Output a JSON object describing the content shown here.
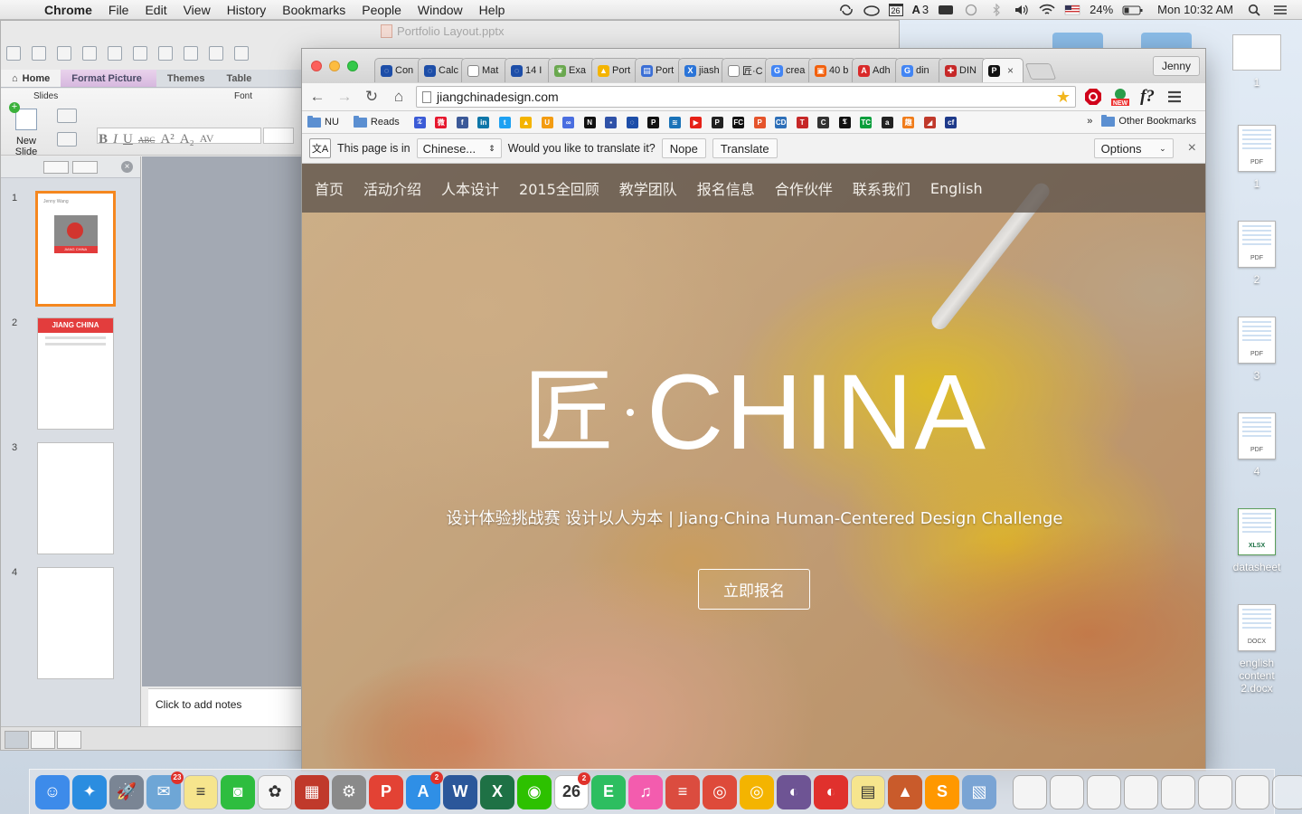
{
  "menubar": {
    "app_name": "Chrome",
    "menus": [
      "File",
      "Edit",
      "View",
      "History",
      "Bookmarks",
      "People",
      "Window",
      "Help"
    ],
    "status": {
      "calendar_day": "26",
      "adobe_count": "3",
      "battery": "24%",
      "clock": "Mon 10:32 AM"
    }
  },
  "powerpoint": {
    "window_title": "Portfolio Layout.pptx",
    "ribbon_tabs": [
      "Home",
      "Format Picture",
      "Themes",
      "Table"
    ],
    "groups": {
      "slides": "Slides",
      "font": "Font"
    },
    "new_slide": "New Slide",
    "format_buttons": [
      "B",
      "I",
      "U",
      "ABC",
      "A²",
      "A₂",
      "AV"
    ],
    "slides": [
      {
        "number": "1",
        "top_text": "Jenny Wang",
        "image_caption": "JIANG CHINA"
      },
      {
        "number": "2",
        "heading": "JIANG CHINA"
      },
      {
        "number": "3"
      },
      {
        "number": "4"
      }
    ],
    "notes_placeholder": "Click to add notes"
  },
  "chrome": {
    "profile": "Jenny",
    "tabs": [
      {
        "label": "Con",
        "fav_color": "#1d4ea8",
        "fav_char": "◌"
      },
      {
        "label": "Calc",
        "fav_color": "#1d4ea8",
        "fav_char": "◌"
      },
      {
        "label": "Mat",
        "fav_color": "#ffffff",
        "fav_char": ""
      },
      {
        "label": "14 I",
        "fav_color": "#1d4ea8",
        "fav_char": "◌"
      },
      {
        "label": "Exa",
        "fav_color": "#6aa84f",
        "fav_char": "❦"
      },
      {
        "label": "Port",
        "fav_color": "#f4b400",
        "fav_char": "▲"
      },
      {
        "label": "Port",
        "fav_color": "#3b6fd6",
        "fav_char": "▤"
      },
      {
        "label": "jiash",
        "fav_color": "#2a74d8",
        "fav_char": "X"
      },
      {
        "label": "匠·C",
        "fav_color": "#ffffff",
        "fav_char": ""
      },
      {
        "label": "crea",
        "fav_color": "#4285f4",
        "fav_char": "G"
      },
      {
        "label": "40 b",
        "fav_color": "#f2600c",
        "fav_char": "▣"
      },
      {
        "label": "Adh",
        "fav_color": "#d92a2a",
        "fav_char": "A"
      },
      {
        "label": "din",
        "fav_color": "#4285f4",
        "fav_char": "G"
      },
      {
        "label": "DIN",
        "fav_color": "#c62828",
        "fav_char": "✚"
      },
      {
        "label": "",
        "fav_color": "#111111",
        "fav_char": "P",
        "active": true
      }
    ],
    "url": "jiangchinadesign.com",
    "bookmarks": [
      {
        "label": "NU",
        "type": "folder"
      },
      {
        "label": "Reads",
        "type": "folder"
      }
    ],
    "bookmark_icons": [
      {
        "name": "tumblr-like-icon",
        "color": "#3b5bd6",
        "char": "𝔗"
      },
      {
        "name": "weibo-icon",
        "color": "#e6162d",
        "char": "微"
      },
      {
        "name": "facebook-icon",
        "color": "#3b5998",
        "char": "f"
      },
      {
        "name": "linkedin-icon",
        "color": "#0e76a8",
        "char": "in"
      },
      {
        "name": "twitter-icon",
        "color": "#1da1f2",
        "char": "t"
      },
      {
        "name": "google-drive-icon",
        "color": "#f4b400",
        "char": "▲"
      },
      {
        "name": "u-icon",
        "color": "#f39c12",
        "char": "U"
      },
      {
        "name": "infinity-icon",
        "color": "#4a6ee0",
        "char": "∞"
      },
      {
        "name": "notion-icon",
        "color": "#111111",
        "char": "N"
      },
      {
        "name": "blue-square-icon",
        "color": "#2f52a8",
        "char": "▪"
      },
      {
        "name": "circle-icon",
        "color": "#1d4ea8",
        "char": "◌"
      },
      {
        "name": "bp-icon",
        "color": "#111111",
        "char": "P"
      },
      {
        "name": "stack-icon",
        "color": "#1a73b8",
        "char": "≋"
      },
      {
        "name": "youtube-icon",
        "color": "#e62117",
        "char": "▶"
      },
      {
        "name": "bp2-icon",
        "color": "#222222",
        "char": "P"
      },
      {
        "name": "fc-icon",
        "color": "#111111",
        "char": "FC"
      },
      {
        "name": "p-icon",
        "color": "#e5542b",
        "char": "P"
      },
      {
        "name": "cd-icon",
        "color": "#2d6fb8",
        "char": "CD"
      },
      {
        "name": "t-icon",
        "color": "#c62828",
        "char": "T"
      },
      {
        "name": "cs-icon",
        "color": "#333333",
        "char": "C"
      },
      {
        "name": "ny-icon",
        "color": "#111111",
        "char": "𝕿"
      },
      {
        "name": "tc-icon",
        "color": "#0a9e3c",
        "char": "TC"
      },
      {
        "name": "amazon-icon",
        "color": "#222222",
        "char": "a"
      },
      {
        "name": "mi-icon",
        "color": "#f07c1a",
        "char": "趣"
      },
      {
        "name": "cap-icon",
        "color": "#c0392b",
        "char": "◢"
      },
      {
        "name": "cf-icon",
        "color": "#1e3a8a",
        "char": "cf"
      }
    ],
    "other_bookmarks": "Other Bookmarks",
    "overflow": "»",
    "translate_bar": {
      "prefix": "This page is in",
      "language": "Chinese...",
      "question": "Would you like to translate it?",
      "nope": "Nope",
      "translate": "Translate",
      "options": "Options",
      "close": "×"
    }
  },
  "site": {
    "nav": [
      "首页",
      "活动介绍",
      "人本设计",
      "2015全回顾",
      "教学团队",
      "报名信息",
      "合作伙伴",
      "联系我们",
      "English"
    ],
    "logo_han": "匠",
    "logo_word": "CHINA",
    "tagline": "设计体验挑战赛 设计以人为本 | Jiang·China Human-Centered Design Challenge",
    "cta": "立即报名"
  },
  "desktop": {
    "files": [
      {
        "label": "1",
        "type": "IMG"
      },
      {
        "label": "1",
        "type": "PDF"
      },
      {
        "label": "2",
        "type": "PDF"
      },
      {
        "label": "3",
        "type": "PDF"
      },
      {
        "label": "4",
        "type": "PDF"
      },
      {
        "label": "datasheet",
        "type": "XLSX"
      },
      {
        "label": "english content 2.docx",
        "type": "DOCX"
      }
    ]
  },
  "dock": {
    "apps": [
      {
        "name": "finder",
        "color": "#3d8bea",
        "char": "☺"
      },
      {
        "name": "safari",
        "color": "#2b8de0",
        "char": "✦"
      },
      {
        "name": "launchpad",
        "color": "#7a8594",
        "char": "🚀"
      },
      {
        "name": "mail",
        "color": "#6ea6d6",
        "char": "✉",
        "badge": "23"
      },
      {
        "name": "notes",
        "color": "#f6e58d",
        "char": "≡"
      },
      {
        "name": "facetime",
        "color": "#2ebd3f",
        "char": "◙"
      },
      {
        "name": "photos",
        "color": "#f5f5f5",
        "char": "✿"
      },
      {
        "name": "photo-booth",
        "color": "#c0392b",
        "char": "▦"
      },
      {
        "name": "system-preferences",
        "color": "#8a8a8a",
        "char": "⚙"
      },
      {
        "name": "wps",
        "color": "#e34234",
        "char": "P"
      },
      {
        "name": "app-store",
        "color": "#2f8fe6",
        "char": "A",
        "badge": "2"
      },
      {
        "name": "word",
        "color": "#2b579a",
        "char": "W"
      },
      {
        "name": "excel",
        "color": "#1e7145",
        "char": "X"
      },
      {
        "name": "wechat",
        "color": "#2dc100",
        "char": "◉"
      },
      {
        "name": "calendar",
        "color": "#ffffff",
        "char": "26",
        "badge": "2"
      },
      {
        "name": "evernote",
        "color": "#2dbe60",
        "char": "E"
      },
      {
        "name": "itunes",
        "color": "#f35cae",
        "char": "♫"
      },
      {
        "name": "wunderlist",
        "color": "#db4c3f",
        "char": "≡"
      },
      {
        "name": "chrome",
        "color": "#de4a3a",
        "char": "◎"
      },
      {
        "name": "chrome-canary",
        "color": "#f4b400",
        "char": "◎"
      },
      {
        "name": "github",
        "color": "#6e5494",
        "char": "◐"
      },
      {
        "name": "netease-music",
        "color": "#e0312d",
        "char": "◐"
      },
      {
        "name": "stickies",
        "color": "#f6e58d",
        "char": "▤"
      },
      {
        "name": "matlab",
        "color": "#c95b2b",
        "char": "▲"
      },
      {
        "name": "sublime",
        "color": "#ff9800",
        "char": "S"
      },
      {
        "name": "preview",
        "color": "#7aa4d4",
        "char": "▧"
      }
    ],
    "docs": [
      {
        "name": "doc-stack-1"
      },
      {
        "name": "doc-stack-2"
      },
      {
        "name": "doc-stack-3"
      },
      {
        "name": "doc-stack-4"
      },
      {
        "name": "doc-stack-5"
      },
      {
        "name": "doc-stack-6"
      },
      {
        "name": "doc-stack-7"
      },
      {
        "name": "trash"
      }
    ]
  }
}
